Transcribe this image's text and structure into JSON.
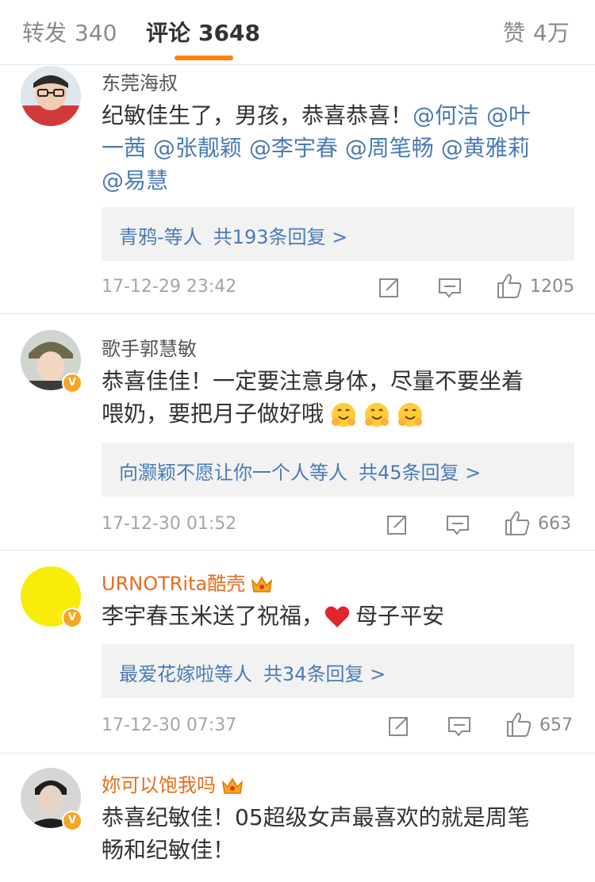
{
  "tabs": {
    "repost": {
      "label": "转发",
      "count": "340"
    },
    "comment": {
      "label": "评论",
      "count": "3648"
    },
    "like": {
      "label": "赞",
      "count": "4万"
    }
  },
  "comments": [
    {
      "user": "东莞海叔",
      "text_parts": [
        "纪敏佳生了，男孩，恭喜恭喜！",
        "@何洁",
        "@叶",
        "一茜",
        "@张靓颖",
        "@李宇春",
        "@周笔畅",
        "@黄雅莉",
        "@易慧"
      ],
      "reply_names": "青鸦-等人",
      "reply_count": "共193条回复 >",
      "time": "17-12-29 23:42",
      "likes": "1205"
    },
    {
      "user": "歌手郭慧敏",
      "verified": "V",
      "text_line1": "恭喜佳佳！一定要注意身体，尽量不要坐着",
      "text_line2": "喂奶，要把月子做好哦",
      "reply_names": "向灏颖不愿让你一个人等人",
      "reply_count": "共45条回复 >",
      "time": "17-12-30 01:52",
      "likes": "663"
    },
    {
      "user": "URNOTRita酷壳",
      "verified": "V",
      "text_a": "李宇春玉米送了祝福，",
      "text_b": "母子平安",
      "reply_names": "最爱花嫁啦等人",
      "reply_count": "共34条回复 >",
      "time": "17-12-30 07:37",
      "likes": "657"
    },
    {
      "user": "妳可以饱我吗",
      "verified": "V",
      "text_line1": "恭喜纪敏佳！05超级女声最喜欢的就是周笔",
      "text_line2": "畅和纪敏佳！"
    }
  ],
  "colors": {
    "accent": "#ff8200",
    "link": "#4a7bb5",
    "vip_name": "#e86c1c",
    "badge": "#f5a623"
  }
}
